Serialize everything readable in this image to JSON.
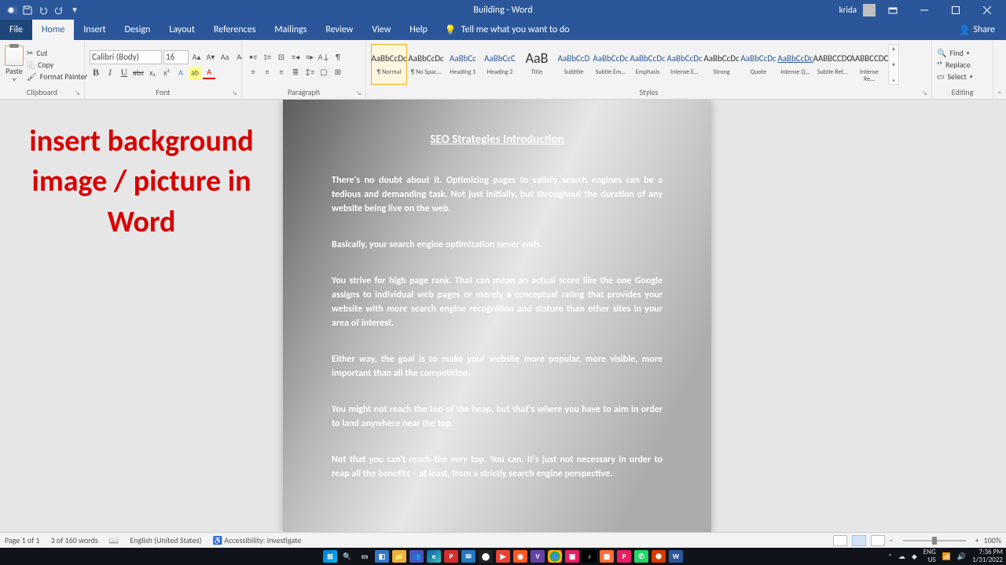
{
  "title": "Building  -  Word",
  "user": "krida",
  "menu": {
    "file": "File",
    "home": "Home",
    "insert": "Insert",
    "design": "Design",
    "layout": "Layout",
    "references": "References",
    "mailings": "Mailings",
    "review": "Review",
    "view": "View",
    "help": "Help",
    "search": "Tell me what you want to do",
    "share": "Share"
  },
  "ribbon": {
    "clipboard": {
      "label": "Clipboard",
      "paste": "Paste",
      "cut": "Cut",
      "copy": "Copy",
      "painter": "Format Painter"
    },
    "font": {
      "label": "Font",
      "name": "Calibri (Body)",
      "size": "16"
    },
    "paragraph": {
      "label": "Paragraph"
    },
    "styles": {
      "label": "Styles",
      "items": [
        {
          "prev": "AaBbCcDc",
          "name": "¶ Normal",
          "cls": "sel"
        },
        {
          "prev": "AaBbCcDc",
          "name": "¶ No Spac..."
        },
        {
          "prev": "AaBbCc",
          "name": "Heading 1",
          "cls": "blue"
        },
        {
          "prev": "AaBbCcC",
          "name": "Heading 2",
          "cls": "blue"
        },
        {
          "prev": "AaB",
          "name": "Title",
          "cls": "title"
        },
        {
          "prev": "AaBbCcD",
          "name": "Subtitle",
          "cls": "blue"
        },
        {
          "prev": "AaBbCcDc",
          "name": "Subtle Em...",
          "cls": "blue"
        },
        {
          "prev": "AaBbCcDc",
          "name": "Emphasis",
          "cls": "blue"
        },
        {
          "prev": "AaBbCcDc",
          "name": "Intense E...",
          "cls": "blue"
        },
        {
          "prev": "AaBbCcDc",
          "name": "Strong"
        },
        {
          "prev": "AaBbCcDc",
          "name": "Quote",
          "cls": "blue"
        },
        {
          "prev": "AaBbCcDc",
          "name": "Intense Q...",
          "cls": "blue under"
        },
        {
          "prev": "AABBCCDC",
          "name": "Subtle Ref..."
        },
        {
          "prev": "AABBCCDC",
          "name": "Intense Re..."
        }
      ]
    },
    "editing": {
      "label": "Editing",
      "find": "Find",
      "replace": "Replace",
      "select": "Select"
    }
  },
  "aside": "insert background image / picture in Word",
  "doc": {
    "heading": "SEO Strategies Introduction",
    "p1": "There's no doubt about it. Optimizing pages to satisfy search engines can be a tedious and demanding task. Not just initially, but throughout the duration of any website being live on the web.",
    "p2": "Basically, your search engine optimization never ends.",
    "p3": "You strive for high page rank. That can mean an actual score like the one Google assigns to individual web pages or merely a conceptual rating that provides your website with more search engine recognition and stature than other sites in your area of interest.",
    "p4": "Either way, the goal is to make your website more popular, more visible, more important than all the competition.",
    "p5": "You might not reach the top of the heap, but that's where you have to aim in order to land anywhere near the top.",
    "p6": "Not that you can't reach the very top. You can. It's just not necessary in order to reap all the benefits – at least, from a strictly search engine perspective."
  },
  "status": {
    "page": "Page 1 of 1",
    "words": "3 of 160 words",
    "lang": "English (United States)",
    "a11y": "Accessibility: Investigate",
    "zoom": "100%"
  },
  "tray": {
    "lang": "ENG",
    "region": "US",
    "time": "7:36 PM",
    "date": "1/31/2022"
  }
}
